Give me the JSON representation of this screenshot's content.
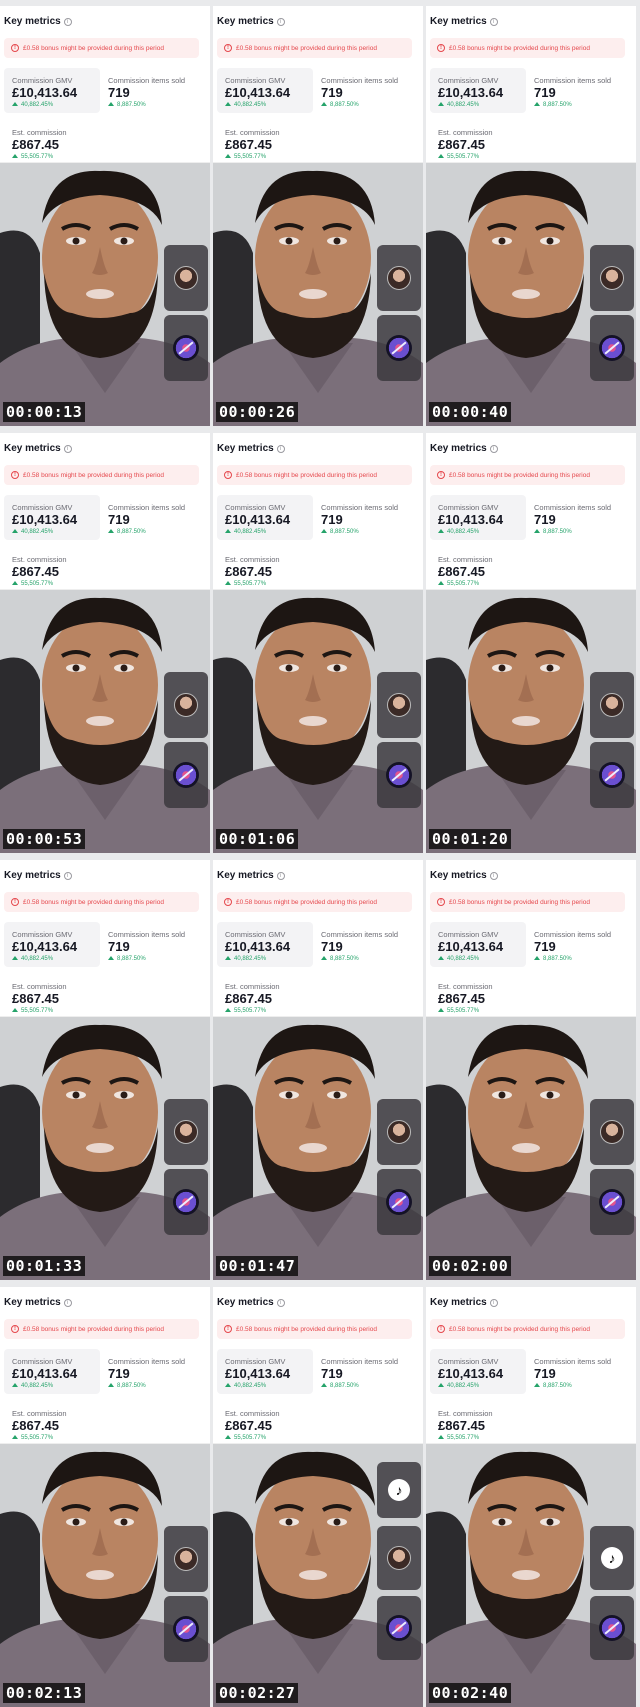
{
  "panel": {
    "title": "Key metrics",
    "info_icon": "info-icon",
    "alert": "£0.58 bonus might be provided during this period",
    "gmv_label": "Commission GMV",
    "gmv_value": "£10,413.64",
    "gmv_change": "40,882.45%",
    "items_label": "Commission items sold",
    "items_value": "719",
    "items_change": "8,887.50%",
    "est_label": "Est. commission",
    "est_value": "£867.45",
    "est_change": "55,505.77%"
  },
  "frames": [
    {
      "timestamp": "00:00:13"
    },
    {
      "timestamp": "00:00:26"
    },
    {
      "timestamp": "00:00:40"
    },
    {
      "timestamp": "00:00:53"
    },
    {
      "timestamp": "00:01:06"
    },
    {
      "timestamp": "00:01:20"
    },
    {
      "timestamp": "00:01:33"
    },
    {
      "timestamp": "00:01:47"
    },
    {
      "timestamp": "00:02:00"
    },
    {
      "timestamp": "00:02:13"
    },
    {
      "timestamp": "00:02:27",
      "tiktok_button": true
    },
    {
      "timestamp": "00:02:40",
      "tiktok_button": true
    }
  ],
  "colors": {
    "accent_green": "#25a36a",
    "alert_red": "#e5484d",
    "alert_bg": "#fdeeee",
    "shirt": "#7b6f7a",
    "skin": "#b98462",
    "hair": "#1d1613"
  },
  "icons": {
    "alert": "alert-circle-icon",
    "trend": "trend-up-icon",
    "creator": "creator-avatar-icon",
    "sound": "sound-disc-icon",
    "tiktok": "tiktok-logo-icon"
  }
}
